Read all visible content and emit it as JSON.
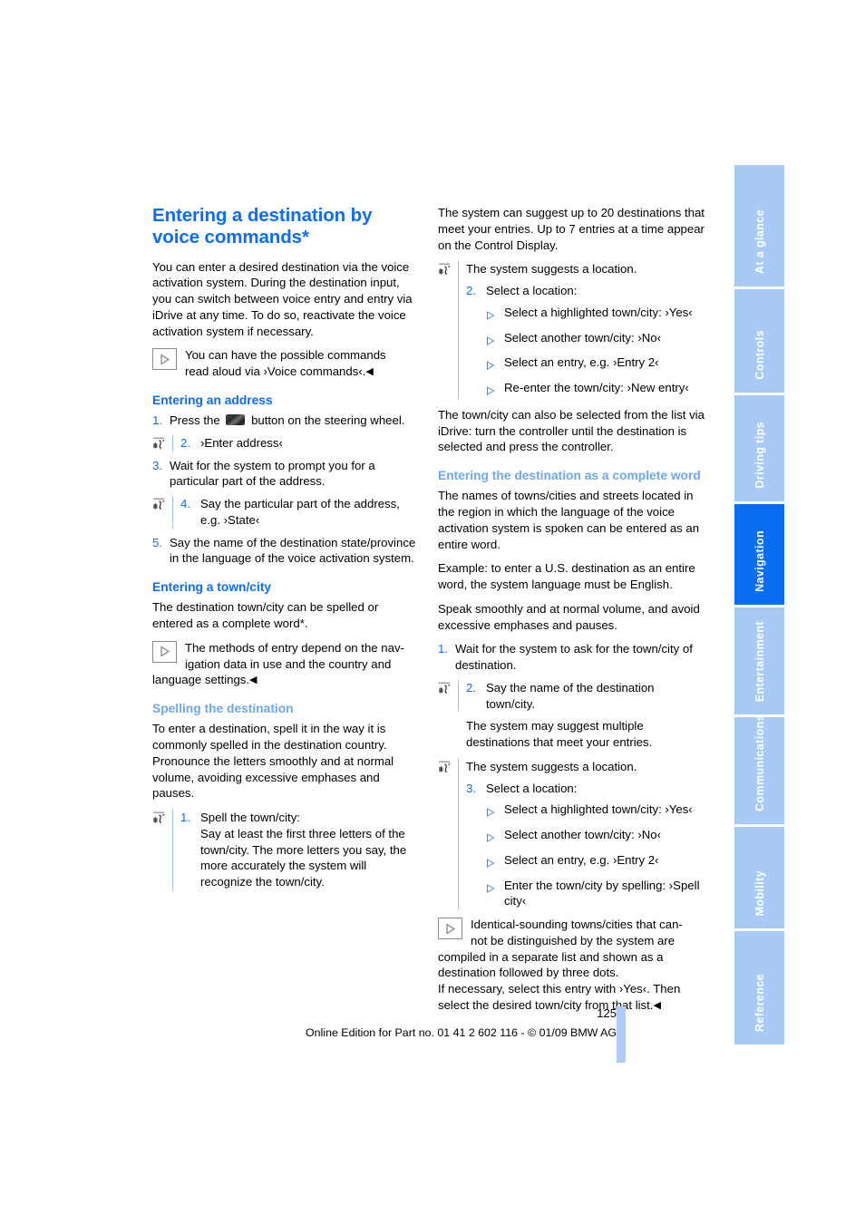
{
  "colors": {
    "accent_blue": "#0a6ef5",
    "light_blue": "#6aa9f2",
    "tab_inactive": "#a8cbf5",
    "rule_blue": "#9fc4ef"
  },
  "sidebar": {
    "tabs": [
      {
        "label": "At a glance",
        "active": false
      },
      {
        "label": "Controls",
        "active": false
      },
      {
        "label": "Driving tips",
        "active": false
      },
      {
        "label": "Navigation",
        "active": true
      },
      {
        "label": "Entertainment",
        "active": false
      },
      {
        "label": "Communications",
        "active": false
      },
      {
        "label": "Mobility",
        "active": false
      },
      {
        "label": "Reference",
        "active": false
      }
    ]
  },
  "left": {
    "title": "Entering a destination by voice commands*",
    "intro": "You can enter a desired destination via the voice activation system. During the destination input, you can switch between voice entry and entry via iDrive at any time. To do so, reactivate the voice activation system if necessary.",
    "note1_line1": "You can have the possible commands",
    "note1_line2": "read aloud via ›Voice commands‹.",
    "h_address": "Entering an address",
    "step1_num": "1.",
    "step1_pre": "Press the",
    "step1_post": "button on the steering wheel.",
    "step2_num": "2.",
    "step2_text": "›Enter address‹",
    "step3_num": "3.",
    "step3_text": "Wait for the system to prompt you for a particular part of the address.",
    "step4_num": "4.",
    "step4_text": "Say the particular part of the address, e.g. ›State‹",
    "step5_num": "5.",
    "step5_text": "Say the name of the destination state/province in the language of the voice activation system.",
    "h_town": "Entering a town/city",
    "town_p1": "The destination town/city can be spelled or entered as a complete word*.",
    "note2_line1": "The methods of entry depend on the nav-",
    "note2_line2": "igation data in use and the country and",
    "note2_cont": "language settings.",
    "h_spelling": "Spelling the destination",
    "spelling_p1": "To enter a destination, spell it in the way it is commonly spelled in the destination country. Pronounce the letters smoothly and at normal volume, avoiding excessive emphases and pauses.",
    "spell_step_num": "1.",
    "spell_step_l1": "Spell the town/city:",
    "spell_step_l2": "Say at least the first three letters of the town/city. The more letters you say, the more accurately the system will recognize the town/city."
  },
  "right": {
    "p1": "The system can suggest up to 20 destinations that meet your entries. Up to 7 entries at a time appear on the Control Display.",
    "suggest_line": "The system suggests a location.",
    "step2_num": "2.",
    "step2_text": "Select a location:",
    "bullets_1": [
      "Select a highlighted town/city: ›Yes‹",
      "Select another town/city: ›No‹",
      "Select an entry, e.g. ›Entry 2‹",
      "Re-enter the town/city: ›New entry‹"
    ],
    "p2": "The town/city can also be selected from the list via iDrive: turn the controller until the destination is selected and press the controller.",
    "h_complete": "Entering the destination as a complete word",
    "p3": "The names of towns/cities and streets located in the region in which the language of the voice activation system is spoken can be entered as an entire word.",
    "p4": "Example: to enter a U.S. destination as an entire word, the system language must be English.",
    "p5": "Speak smoothly and at normal volume, and avoid excessive emphases and pauses.",
    "step1_num": "1.",
    "step1_text": "Wait for the system to ask for the town/city of destination.",
    "vstep2_num": "2.",
    "vstep2_text": "Say the name of the destination town/city.",
    "p6": "The system may suggest multiple destinations that meet your entries.",
    "suggest_line2": "The system suggests a location.",
    "step3_num": "3.",
    "step3_text": "Select a location:",
    "bullets_2": [
      "Select a highlighted town/city: ›Yes‹",
      "Select another town/city: ›No‹",
      "Select an entry, e.g. ›Entry 2‹",
      "Enter the town/city by spelling: ›Spell city‹"
    ],
    "note3_line1": "Identical-sounding towns/cities that can-",
    "note3_line2": "not be distinguished by the system are",
    "note3_cont": "compiled in a separate list and shown as a destination followed by three dots.",
    "note3_last": "If necessary, select this entry with ›Yes‹. Then select the desired town/city from that list."
  },
  "footer": {
    "page_number": "125",
    "edition": "Online Edition for Part no. 01 41 2 602 116 - © 01/09 BMW AG"
  }
}
